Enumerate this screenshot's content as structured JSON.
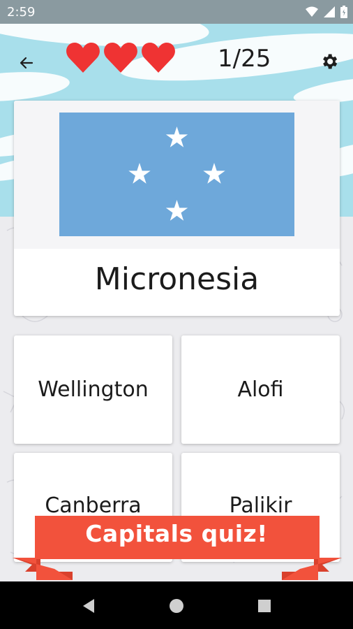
{
  "status_bar": {
    "time": "2:59",
    "icons": [
      "wifi-icon",
      "signal-icon",
      "battery-icon"
    ]
  },
  "header": {
    "back_icon": "arrow-left-icon",
    "lives": 3,
    "progress": "1/25",
    "settings_icon": "gear-icon"
  },
  "question": {
    "flag": "flag-of-micronesia",
    "country": "Micronesia"
  },
  "answers": [
    {
      "label": "Wellington"
    },
    {
      "label": "Alofi"
    },
    {
      "label": "Canberra"
    },
    {
      "label": "Palikir"
    }
  ],
  "banner": {
    "text": "Capitals quiz!"
  },
  "colors": {
    "sky": "#a8dfeb",
    "flag_blue": "#6ea8da",
    "heart": "#ef3333",
    "banner": "#f2523c"
  },
  "nav": {
    "back": "nav-back-icon",
    "home": "nav-home-icon",
    "recents": "nav-recents-icon"
  }
}
